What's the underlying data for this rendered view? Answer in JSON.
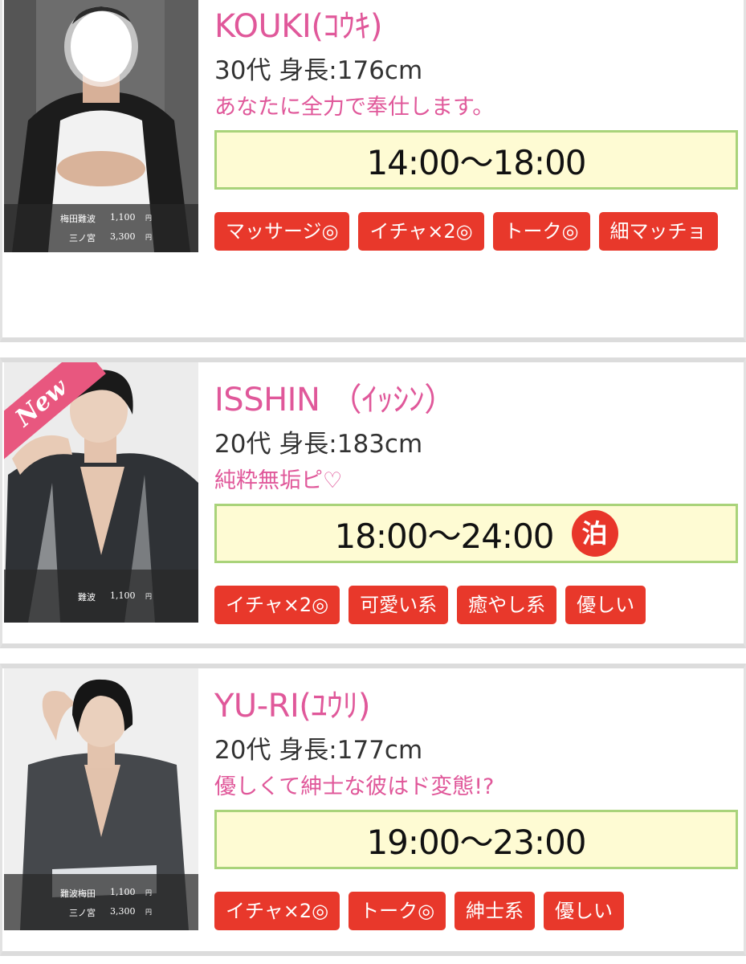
{
  "cast": [
    {
      "name": "KOUKI(ｺｳｷ)",
      "stats": "30代 身長:176cm",
      "catchphrase": "あなたに全力で奉仕します。",
      "time": "14:00〜18:00",
      "stay_badge": "",
      "tags": [
        "マッサージ◎",
        "イチャ×2◎",
        "トーク◎",
        "細マッチョ"
      ],
      "is_new": false,
      "prices": [
        {
          "area": "梅田難波",
          "price": "1,100",
          "unit": "円"
        },
        {
          "area": "三ノ宮",
          "price": "3,300",
          "unit": "円"
        }
      ]
    },
    {
      "name": "ISSHIN （ｲｯｼﾝ）",
      "stats": "20代 身長:183cm",
      "catchphrase": "純粋無垢ピ♡",
      "time": "18:00〜24:00",
      "stay_badge": "泊",
      "tags": [
        "イチャ×2◎",
        "可愛い系",
        "癒やし系",
        "優しい"
      ],
      "is_new": true,
      "new_label": "New",
      "prices": [
        {
          "area": "難波",
          "price": "1,100",
          "unit": "円"
        }
      ]
    },
    {
      "name": "YU-RI(ﾕｳﾘ)",
      "stats": "20代 身長:177cm",
      "catchphrase": "優しくて紳士な彼はド変態!?",
      "time": "19:00〜23:00",
      "stay_badge": "",
      "tags": [
        "イチャ×2◎",
        "トーク◎",
        "紳士系",
        "優しい"
      ],
      "is_new": false,
      "prices": [
        {
          "area": "難波梅田",
          "price": "1,100",
          "unit": "円"
        },
        {
          "area": "三ノ宮",
          "price": "3,300",
          "unit": "円"
        }
      ]
    }
  ]
}
